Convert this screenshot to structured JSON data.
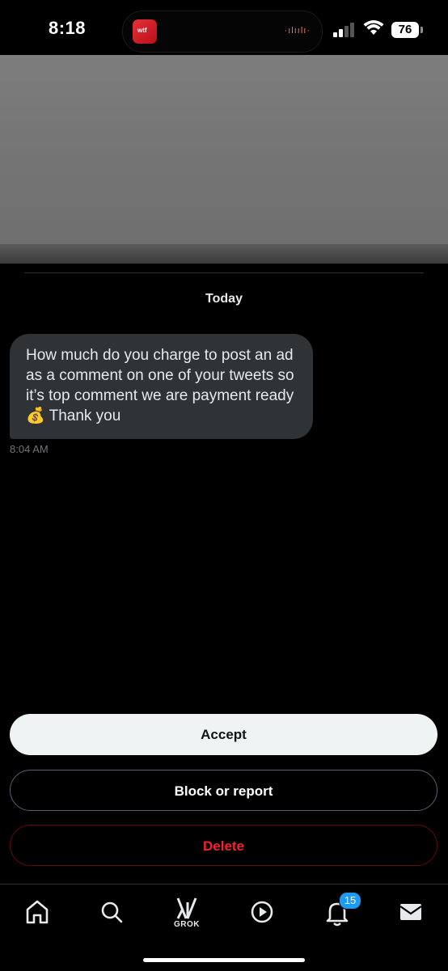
{
  "status_bar": {
    "time": "8:18",
    "battery": "76"
  },
  "conversation": {
    "date_separator": "Today",
    "message": {
      "text": "How much do you charge to post an ad as a comment on one of your tweets so it’s top comment we are payment ready 💰 Thank you",
      "time": "8:04 AM"
    }
  },
  "actions": {
    "accept": "Accept",
    "block_report": "Block or report",
    "delete": "Delete"
  },
  "tab_bar": {
    "items": [
      {
        "name": "home-icon"
      },
      {
        "name": "search-icon"
      },
      {
        "name": "grok-icon",
        "label": "GROK"
      },
      {
        "name": "play-icon"
      },
      {
        "name": "bell-icon"
      },
      {
        "name": "mail-icon"
      }
    ],
    "notifications_badge": "15"
  },
  "colors": {
    "accent_blue": "#1d9bf0",
    "delete_red": "#f4212e",
    "bubble": "#2f3336"
  }
}
